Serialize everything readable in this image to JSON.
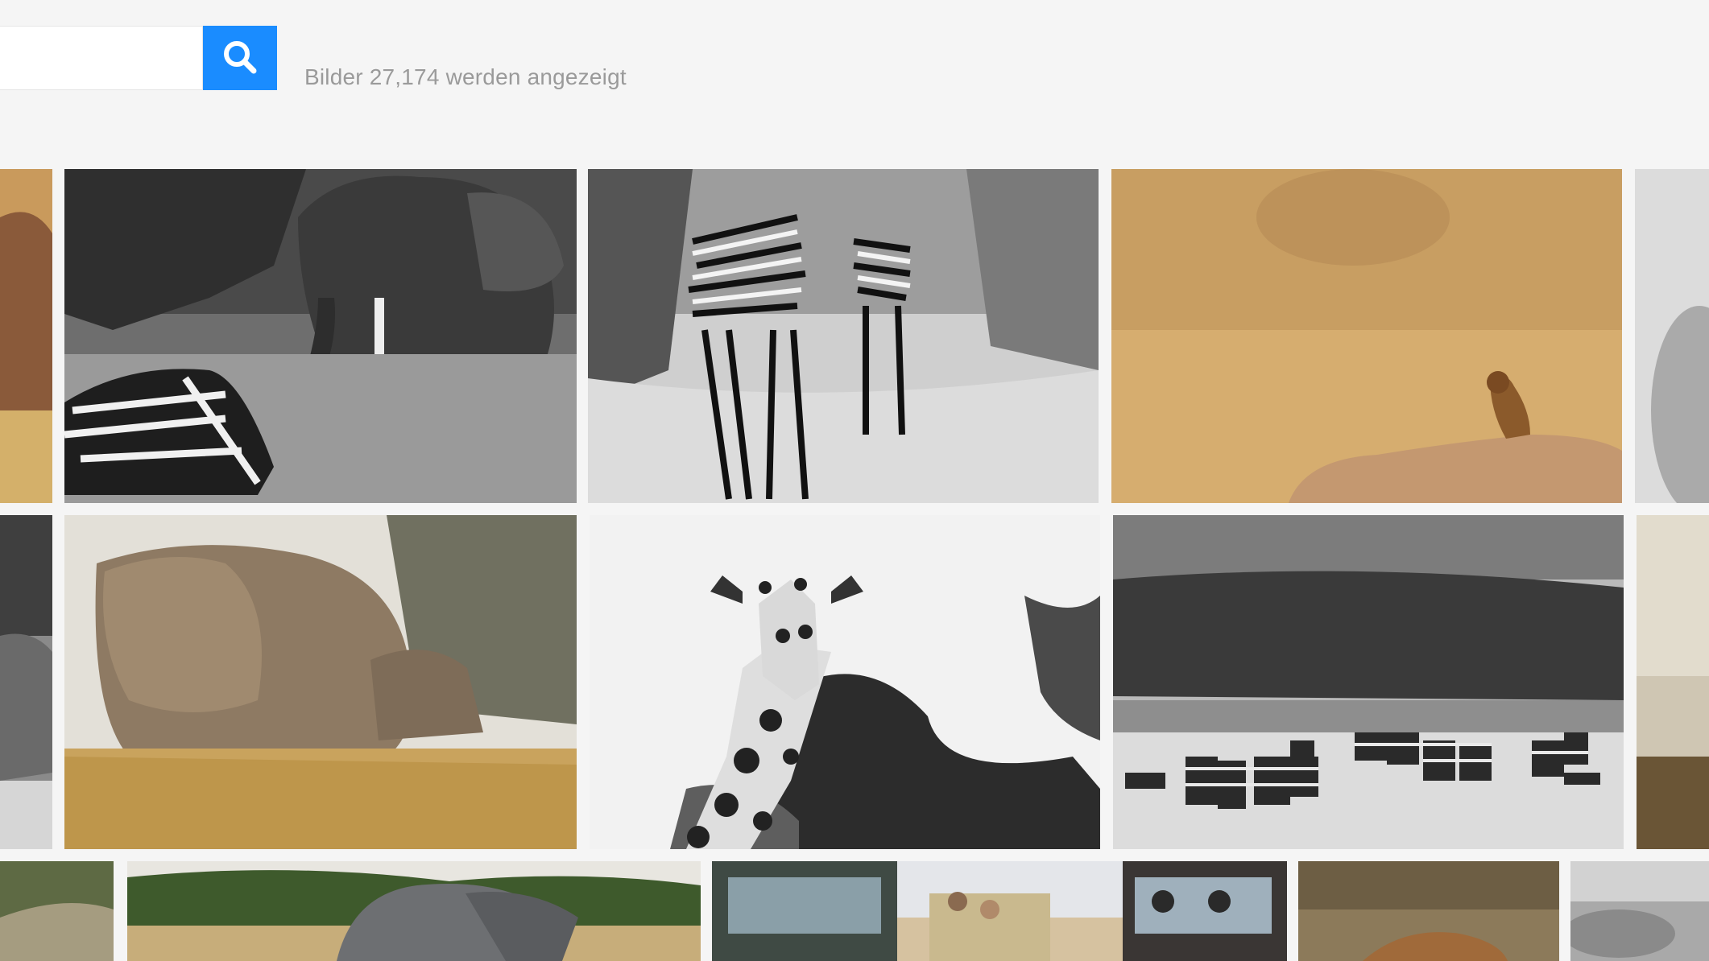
{
  "search": {
    "value": "",
    "placeholder": "",
    "icon": "search-icon"
  },
  "results": {
    "count_text": "Bilder 27,174 werden angezeigt"
  },
  "colors": {
    "background": "#f5f5f5",
    "accent": "#1a8cff",
    "count_text": "#9a9a9a"
  },
  "gallery": {
    "tiles": [
      {
        "subject": "warthog-in-grass",
        "tone": "color"
      },
      {
        "subject": "elephant-and-zebra",
        "tone": "bw"
      },
      {
        "subject": "zebras-on-road",
        "tone": "bw"
      },
      {
        "subject": "mongoose-on-rock",
        "tone": "color"
      },
      {
        "subject": "blurred-tree",
        "tone": "bw"
      },
      {
        "subject": "elephants-edge",
        "tone": "bw"
      },
      {
        "subject": "elephant-in-grass",
        "tone": "color"
      },
      {
        "subject": "giraffe-portrait",
        "tone": "bw"
      },
      {
        "subject": "zebra-herd-under-clouds",
        "tone": "bw"
      },
      {
        "subject": "savanna-edge",
        "tone": "color"
      },
      {
        "subject": "tree-edge",
        "tone": "color"
      },
      {
        "subject": "elephant-in-savanna",
        "tone": "color"
      },
      {
        "subject": "safari-jeeps",
        "tone": "color"
      },
      {
        "subject": "lion-resting",
        "tone": "color"
      },
      {
        "subject": "grey-edge",
        "tone": "bw"
      }
    ]
  }
}
